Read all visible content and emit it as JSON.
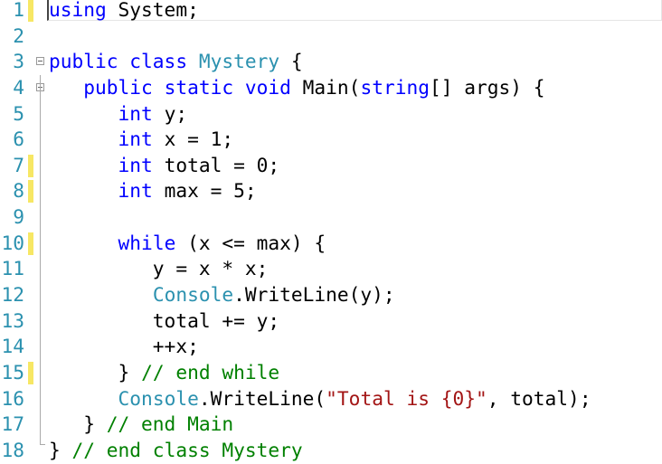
{
  "colors": {
    "keyword": "#0000ff",
    "type": "#2b91af",
    "string": "#a31515",
    "comment": "#008000",
    "line_number": "#2b91af",
    "change_marker": "#f7e764"
  },
  "lines": [
    {
      "n": "1",
      "mark": true,
      "cur": true,
      "tokens": [
        [
          "kw",
          "using"
        ],
        [
          "pl",
          " System;"
        ]
      ]
    },
    {
      "n": "2",
      "tokens": []
    },
    {
      "n": "3",
      "fold": true,
      "tokens": [
        [
          "kw",
          "public class"
        ],
        [
          "pl",
          " "
        ],
        [
          "ty",
          "Mystery"
        ],
        [
          "pl",
          " {"
        ]
      ]
    },
    {
      "n": "4",
      "fold": true,
      "tokens": [
        [
          "pl",
          "   "
        ],
        [
          "kw",
          "public static void"
        ],
        [
          "pl",
          " Main("
        ],
        [
          "kw",
          "string"
        ],
        [
          "pl",
          "[] args) {"
        ]
      ]
    },
    {
      "n": "5",
      "tokens": [
        [
          "pl",
          "      "
        ],
        [
          "kw",
          "int"
        ],
        [
          "pl",
          " y;"
        ]
      ]
    },
    {
      "n": "6",
      "tokens": [
        [
          "pl",
          "      "
        ],
        [
          "kw",
          "int"
        ],
        [
          "pl",
          " x = 1;"
        ]
      ]
    },
    {
      "n": "7",
      "mark": true,
      "tokens": [
        [
          "pl",
          "      "
        ],
        [
          "kw",
          "int"
        ],
        [
          "pl",
          " total = 0;"
        ]
      ]
    },
    {
      "n": "8",
      "mark": true,
      "tokens": [
        [
          "pl",
          "      "
        ],
        [
          "kw",
          "int"
        ],
        [
          "pl",
          " max = 5;"
        ]
      ]
    },
    {
      "n": "9",
      "tokens": []
    },
    {
      "n": "10",
      "mark": true,
      "tokens": [
        [
          "pl",
          "      "
        ],
        [
          "kw",
          "while"
        ],
        [
          "pl",
          " (x <= max) {"
        ]
      ]
    },
    {
      "n": "11",
      "tokens": [
        [
          "pl",
          "         y = x * x;"
        ]
      ]
    },
    {
      "n": "12",
      "tokens": [
        [
          "pl",
          "         "
        ],
        [
          "ty",
          "Console"
        ],
        [
          "pl",
          ".WriteLine(y);"
        ]
      ]
    },
    {
      "n": "13",
      "tokens": [
        [
          "pl",
          "         total += y;"
        ]
      ]
    },
    {
      "n": "14",
      "tokens": [
        [
          "pl",
          "         ++x;"
        ]
      ]
    },
    {
      "n": "15",
      "mark": true,
      "tokens": [
        [
          "pl",
          "      } "
        ],
        [
          "cm",
          "// end while"
        ]
      ]
    },
    {
      "n": "16",
      "tokens": [
        [
          "pl",
          "      "
        ],
        [
          "ty",
          "Console"
        ],
        [
          "pl",
          ".WriteLine("
        ],
        [
          "st",
          "\"Total is {0}\""
        ],
        [
          "pl",
          ", total);"
        ]
      ]
    },
    {
      "n": "17",
      "tokens": [
        [
          "pl",
          "   } "
        ],
        [
          "cm",
          "// end Main"
        ]
      ]
    },
    {
      "n": "18",
      "tokens": [
        [
          "pl",
          "} "
        ],
        [
          "cm",
          "// end class Mystery"
        ]
      ]
    }
  ]
}
